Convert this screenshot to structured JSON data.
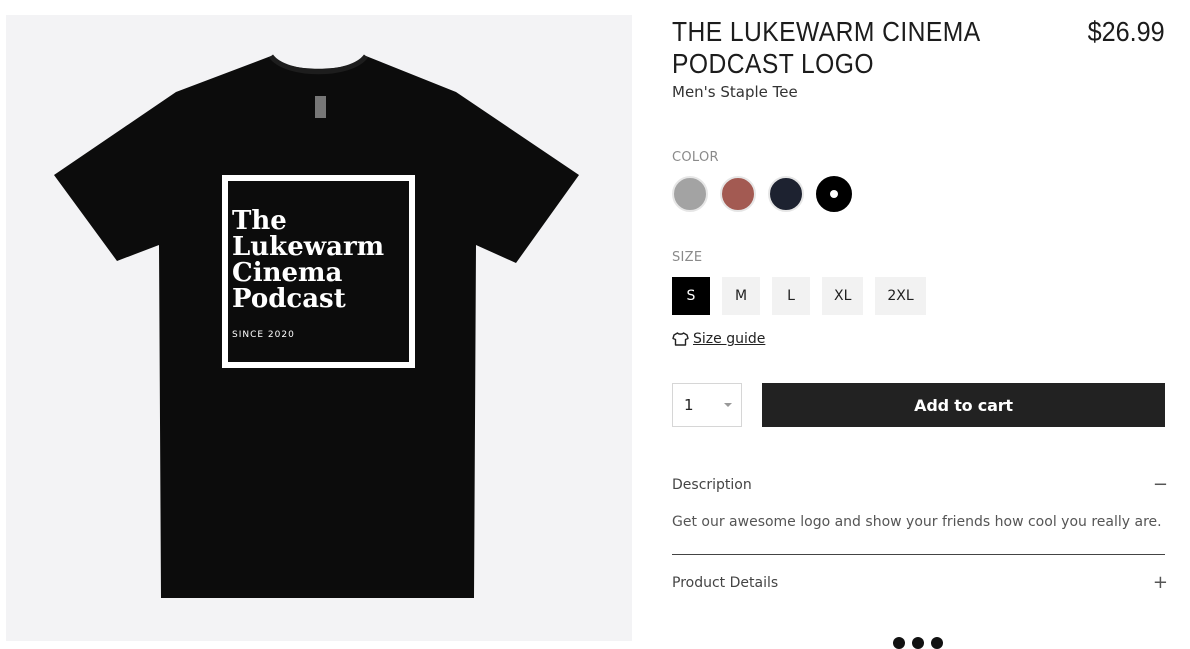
{
  "product": {
    "title": "THE LUKEWARM CINEMA PODCAST LOGO",
    "price": "$26.99",
    "subtitle": "Men's Staple Tee",
    "print": {
      "line1": "The",
      "line2": "Lukewarm",
      "line3": "Cinema",
      "line4": "Podcast",
      "since": "SINCE 2020"
    }
  },
  "color": {
    "label": "COLOR",
    "options": [
      {
        "name": "gray",
        "hex": "#a3a3a3",
        "selected": false
      },
      {
        "name": "rust",
        "hex": "#a35a52",
        "selected": false
      },
      {
        "name": "navy",
        "hex": "#1d2230",
        "selected": false
      },
      {
        "name": "black",
        "hex": "#000000",
        "selected": true
      }
    ]
  },
  "size": {
    "label": "SIZE",
    "options": [
      "S",
      "M",
      "L",
      "XL",
      "2XL"
    ],
    "selected": "S",
    "guide_label": "Size guide"
  },
  "cart": {
    "quantity": "1",
    "add_label": "Add to cart"
  },
  "accordion": {
    "description": {
      "title": "Description",
      "toggle": "−",
      "body": "Get our awesome logo and show your friends how cool you really are."
    },
    "details": {
      "title": "Product Details",
      "toggle": "+"
    }
  }
}
